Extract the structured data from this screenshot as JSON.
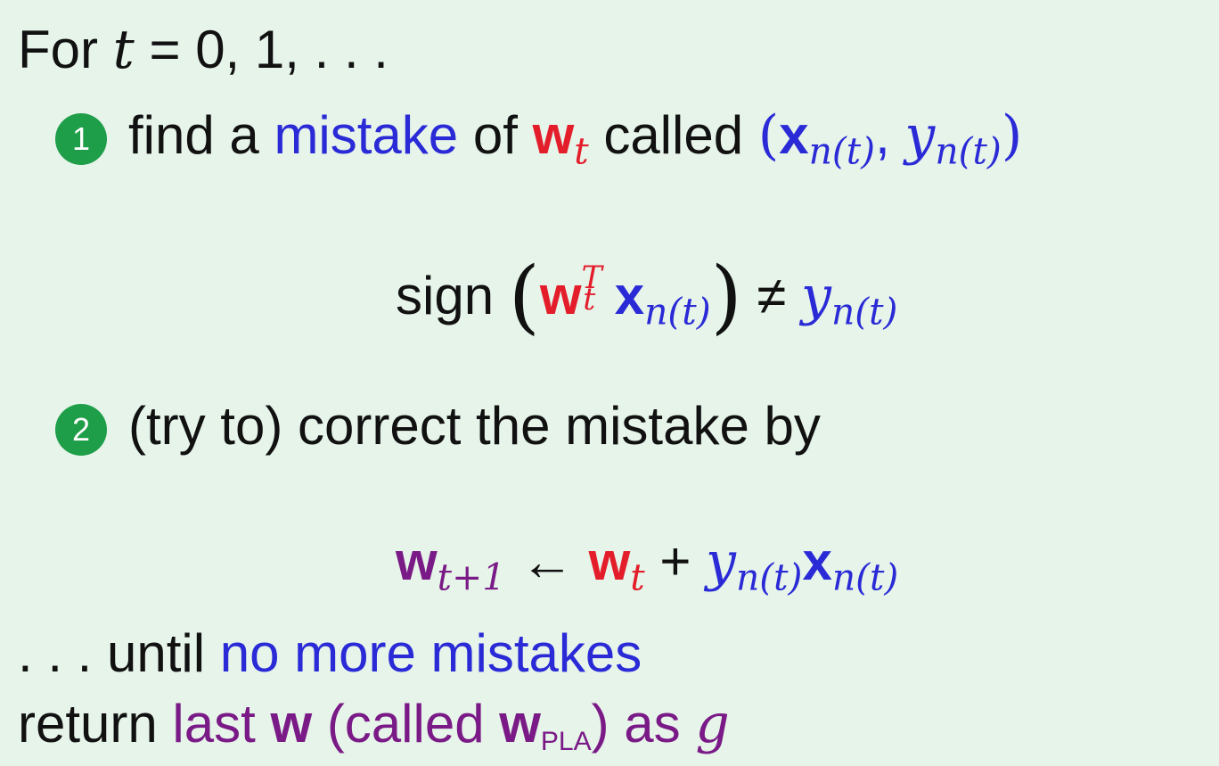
{
  "loop_header": {
    "for_word": "For",
    "t_var": "t",
    "eq": "=",
    "values": "0, 1, . . ."
  },
  "step1": {
    "badge": "1",
    "text_find": "find a",
    "text_mistake": "mistake",
    "text_of": "of",
    "w": "w",
    "t_sub": "t",
    "text_called": "called",
    "lparen": "(",
    "x": "x",
    "n_t": "n(t)",
    "comma": ",",
    "y": "y",
    "rparen": ")"
  },
  "eq1": {
    "sign": "sign",
    "lparen": "(",
    "w": "w",
    "T_sup": "T",
    "t_sub": "t",
    "x": "x",
    "n_t": "n(t)",
    "rparen": ")",
    "neq": "≠",
    "y": "y"
  },
  "step2": {
    "badge": "2",
    "text": "(try to) correct the mistake by"
  },
  "eq2": {
    "w_lhs": "w",
    "lhs_sub": "t+1",
    "arrow": "←",
    "w_rhs": "w",
    "t_sub": "t",
    "plus": "+",
    "y": "y",
    "n_t": "n(t)",
    "x": "x"
  },
  "until_line": {
    "prefix": ". . . until",
    "highlight": "no more mistakes"
  },
  "return_line": {
    "return_word": "return",
    "last": "last",
    "w": "w",
    "called_open": "(called",
    "pla_sub": "PLA",
    "called_close": ")",
    "as_word": "as",
    "g": "g"
  },
  "colors": {
    "background": "#e6f4ea",
    "red": "#e41d2b",
    "blue": "#2a2ad6",
    "purple": "#7a1a86",
    "badge": "#1f9e49"
  }
}
